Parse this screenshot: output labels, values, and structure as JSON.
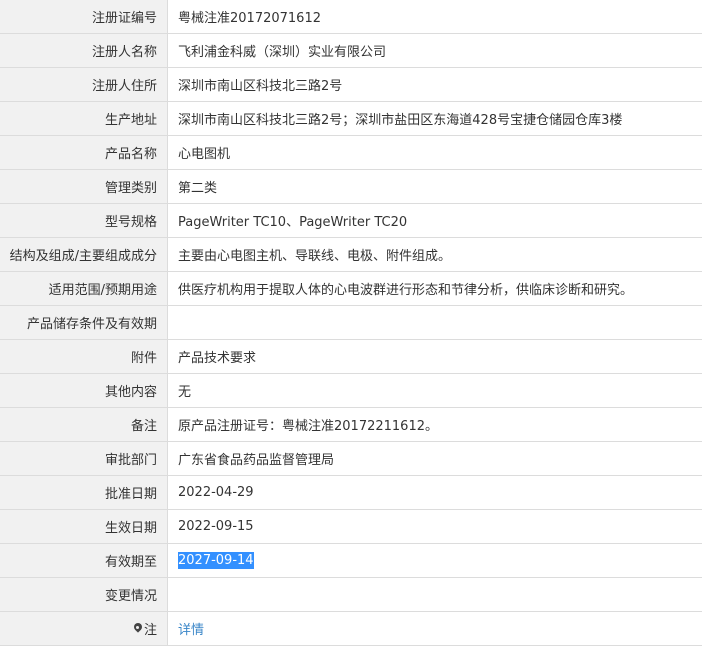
{
  "rows": [
    {
      "label": "注册证编号",
      "value": "粤械注准20172071612"
    },
    {
      "label": "注册人名称",
      "value": "飞利浦金科威（深圳）实业有限公司"
    },
    {
      "label": "注册人住所",
      "value": "深圳市南山区科技北三路2号"
    },
    {
      "label": "生产地址",
      "value": "深圳市南山区科技北三路2号；深圳市盐田区东海道428号宝捷仓储园仓库3楼"
    },
    {
      "label": "产品名称",
      "value": "心电图机"
    },
    {
      "label": "管理类别",
      "value": "第二类"
    },
    {
      "label": "型号规格",
      "value": "PageWriter TC10、PageWriter TC20"
    },
    {
      "label": "结构及组成/主要组成成分",
      "value": "主要由心电图主机、导联线、电极、附件组成。"
    },
    {
      "label": "适用范围/预期用途",
      "value": "供医疗机构用于提取人体的心电波群进行形态和节律分析，供临床诊断和研究。"
    },
    {
      "label": "产品储存条件及有效期",
      "value": ""
    },
    {
      "label": "附件",
      "value": "产品技术要求"
    },
    {
      "label": "其他内容",
      "value": "无"
    },
    {
      "label": "备注",
      "value": "原产品注册证号：粤械注准20172211612。"
    },
    {
      "label": "审批部门",
      "value": "广东省食品药品监督管理局"
    },
    {
      "label": "批准日期",
      "value": "2022-04-29"
    },
    {
      "label": "生效日期",
      "value": "2022-09-15"
    },
    {
      "label": "有效期至",
      "value": "2027-09-14"
    },
    {
      "label": "变更情况",
      "value": ""
    },
    {
      "label": "注",
      "value": "详情",
      "label_icon": "map-pin-icon"
    }
  ],
  "selection_color": "#3390ff",
  "link_color": "#3a86c8"
}
